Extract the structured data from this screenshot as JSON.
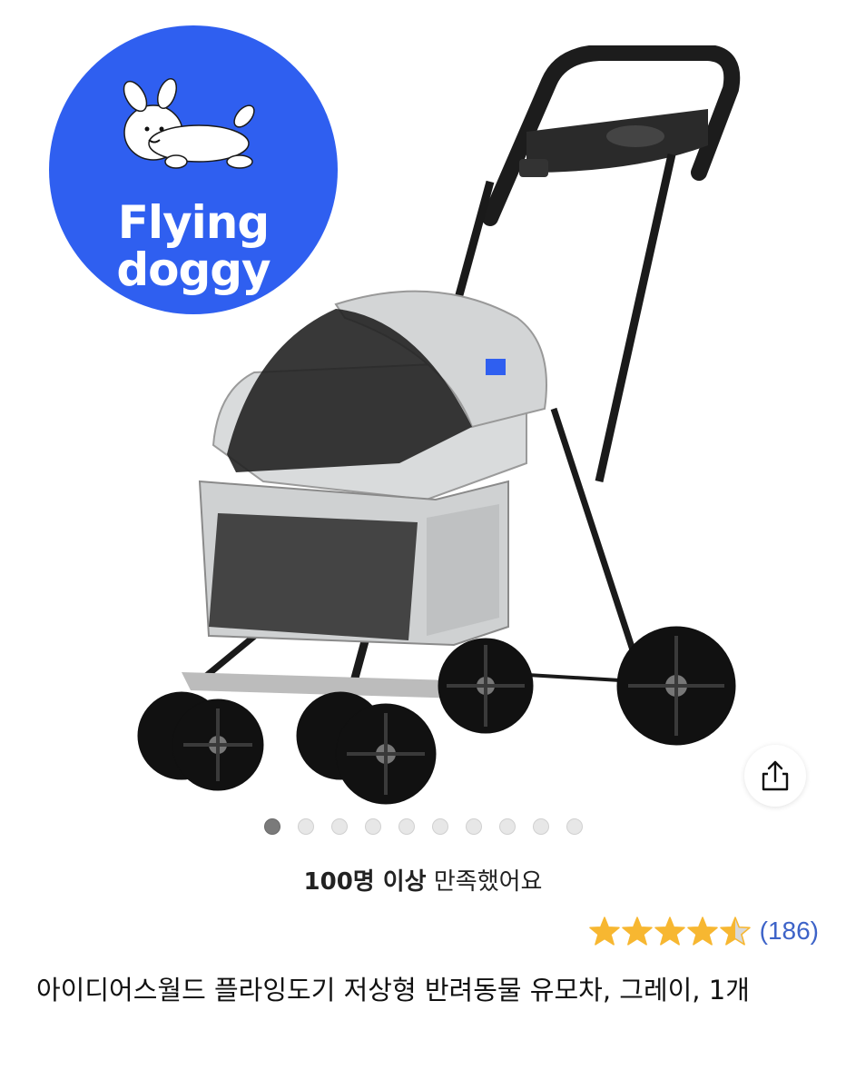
{
  "logo": {
    "line1": "Flying",
    "line2": "doggy"
  },
  "carousel": {
    "total": 10,
    "active_index": 0
  },
  "share": {
    "icon": "share-icon"
  },
  "satisfaction": {
    "bold": "100명 이상",
    "rest": " 만족했어요"
  },
  "rating": {
    "value": 4.5,
    "max": 5,
    "count_text": "(186)",
    "star_color": "#f7b731"
  },
  "product": {
    "title": "아이디어스월드 플라잉도기 저상형 반려동물 유모차, 그레이, 1개"
  },
  "colors": {
    "brand_blue": "#2f5ff0",
    "link_blue": "#3d63c8"
  }
}
